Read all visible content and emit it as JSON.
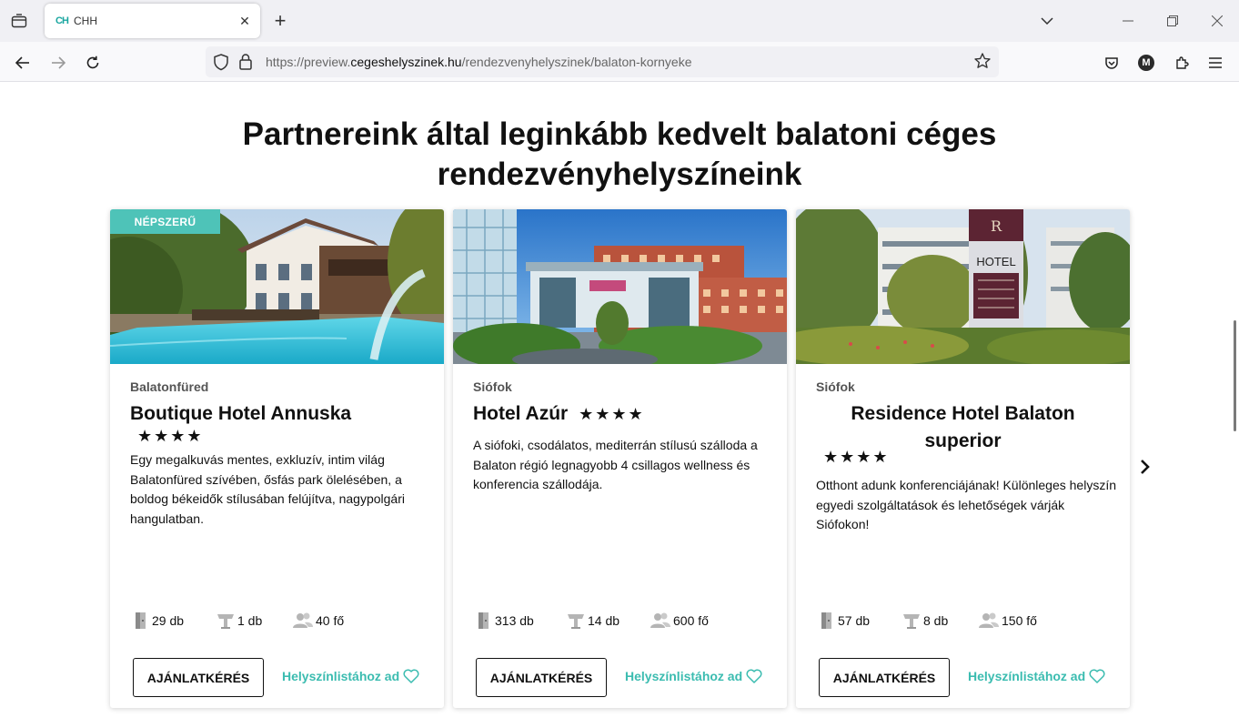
{
  "browser": {
    "tab_title": "CHH",
    "favicon_text": "CH",
    "url_prefix": "https://preview.",
    "url_host": "cegeshelyszinek.hu",
    "url_path": "/rendezvenyhelyszinek/balaton-kornyeke",
    "account_initial": "M"
  },
  "page": {
    "heading_line1": "Partnereink által leginkább kedvelt balatoni céges",
    "heading_line2": "rendezvényhelyszíneink"
  },
  "colors": {
    "accent": "#4ec3b8",
    "link": "#3bbcb0"
  },
  "cards": [
    {
      "badge": "NÉPSZERŰ",
      "location": "Balatonfüred",
      "name": "Boutique Hotel Annuska",
      "stars": "★★★★",
      "description": "Egy megalkuvás mentes, exkluzív, intim világ Balatonfüred szívében, ősfás park ölelésében, a boldog békeidők stílusában felújítva, nagypolgári hangulatban.",
      "rooms": "29 db",
      "halls": "1 db",
      "capacity": "40 fő",
      "offer_button": "AJÁNLATKÉRÉS",
      "add_to_list": "Helyszínlistához ad"
    },
    {
      "location": "Siófok",
      "name": "Hotel Azúr",
      "stars": "★★★★",
      "description": "A siófoki, csodálatos, mediterrán stílusú szálloda a Balaton régió legnagyobb 4 csillagos wellness és konferencia szállodája.",
      "rooms": "313 db",
      "halls": "14 db",
      "capacity": "600 fő",
      "offer_button": "AJÁNLATKÉRÉS",
      "add_to_list": "Helyszínlistához ad"
    },
    {
      "location": "Siófok",
      "name_line1": "Residence Hotel Balaton",
      "name_line2": "superior",
      "stars": "★★★★",
      "description": "Otthont adunk konferenciájának! Különleges helyszín egyedi szolgáltatások és lehetőségek várják Siófokon!",
      "rooms": "57 db",
      "halls": "8 db",
      "capacity": "150 fő",
      "offer_button": "AJÁNLATKÉRÉS",
      "add_to_list": "Helyszínlistához ad",
      "sign_text": "HOTEL"
    }
  ]
}
